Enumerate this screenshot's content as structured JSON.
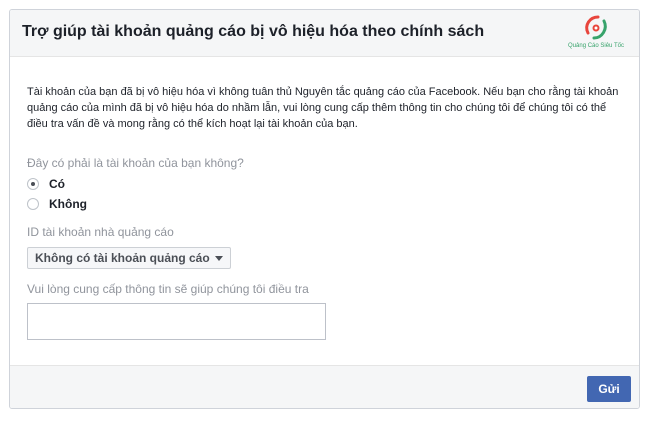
{
  "dialog": {
    "title": "Trợ giúp tài khoản quảng cáo bị vô hiệu hóa theo chính sách",
    "logo_text": "Quảng Cáo Siêu Tốc"
  },
  "form": {
    "description": "Tài khoản của bạn đã bị vô hiệu hóa vì không tuân thủ Nguyên tắc quảng cáo của Facebook. Nếu bạn cho rằng tài khoản quảng cáo của mình đã bị vô hiệu hóa do nhầm lẫn, vui lòng cung cấp thêm thông tin cho chúng tôi để chúng tôi có thể điều tra vấn đề và mong rằng có thể kích hoạt lại tài khoản của bạn.",
    "question": "Đây có phải là tài khoản của bạn không?",
    "options": [
      {
        "label": "Có",
        "checked": true
      },
      {
        "label": "Không",
        "checked": false
      }
    ],
    "ad_account_label": "ID tài khoản nhà quảng cáo",
    "ad_account_selected": "Không có tài khoản quảng cáo",
    "info_label": "Vui lòng cung cấp thông tin sẽ giúp chúng tôi điều tra",
    "info_value": ""
  },
  "footer": {
    "submit_label": "Gửi",
    "submit_color": "#4267b2"
  }
}
